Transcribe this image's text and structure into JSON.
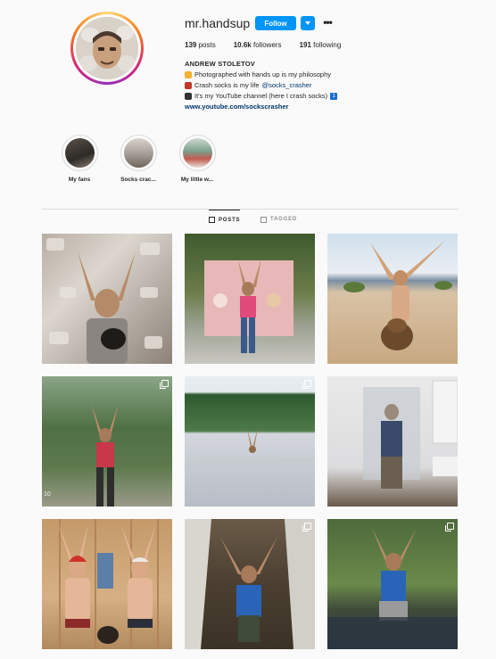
{
  "profile": {
    "username": "mr.handsup",
    "follow_label": "Follow",
    "more_label": "•••",
    "stats": {
      "posts_count": "139",
      "posts_label": "posts",
      "followers_count": "10.6k",
      "followers_label": "followers",
      "following_count": "191",
      "following_label": "following"
    },
    "full_name": "ANDREW STOLETOV",
    "bio": {
      "line1": "Photographed with hands up is my philosophy",
      "line2_text": "Crash socks is my life",
      "line2_mention": "@socks_crasher",
      "line3": "It's my YouTube channel (here I crash socks)",
      "line3_badge": "1"
    },
    "link": "www.youtube.com/sockscrasher"
  },
  "highlights": [
    {
      "label": "My fans"
    },
    {
      "label": "Socks crac..."
    },
    {
      "label": "My little w..."
    }
  ],
  "tabs": {
    "posts_label": "POSTS",
    "tagged_label": "TAGGED"
  },
  "posts": {
    "item_4_overlay": "10"
  },
  "colors": {
    "accent": "#0095f6",
    "text": "#262626",
    "secondary": "#8e8e8e",
    "link": "#00376b",
    "background": "#fafafa"
  }
}
